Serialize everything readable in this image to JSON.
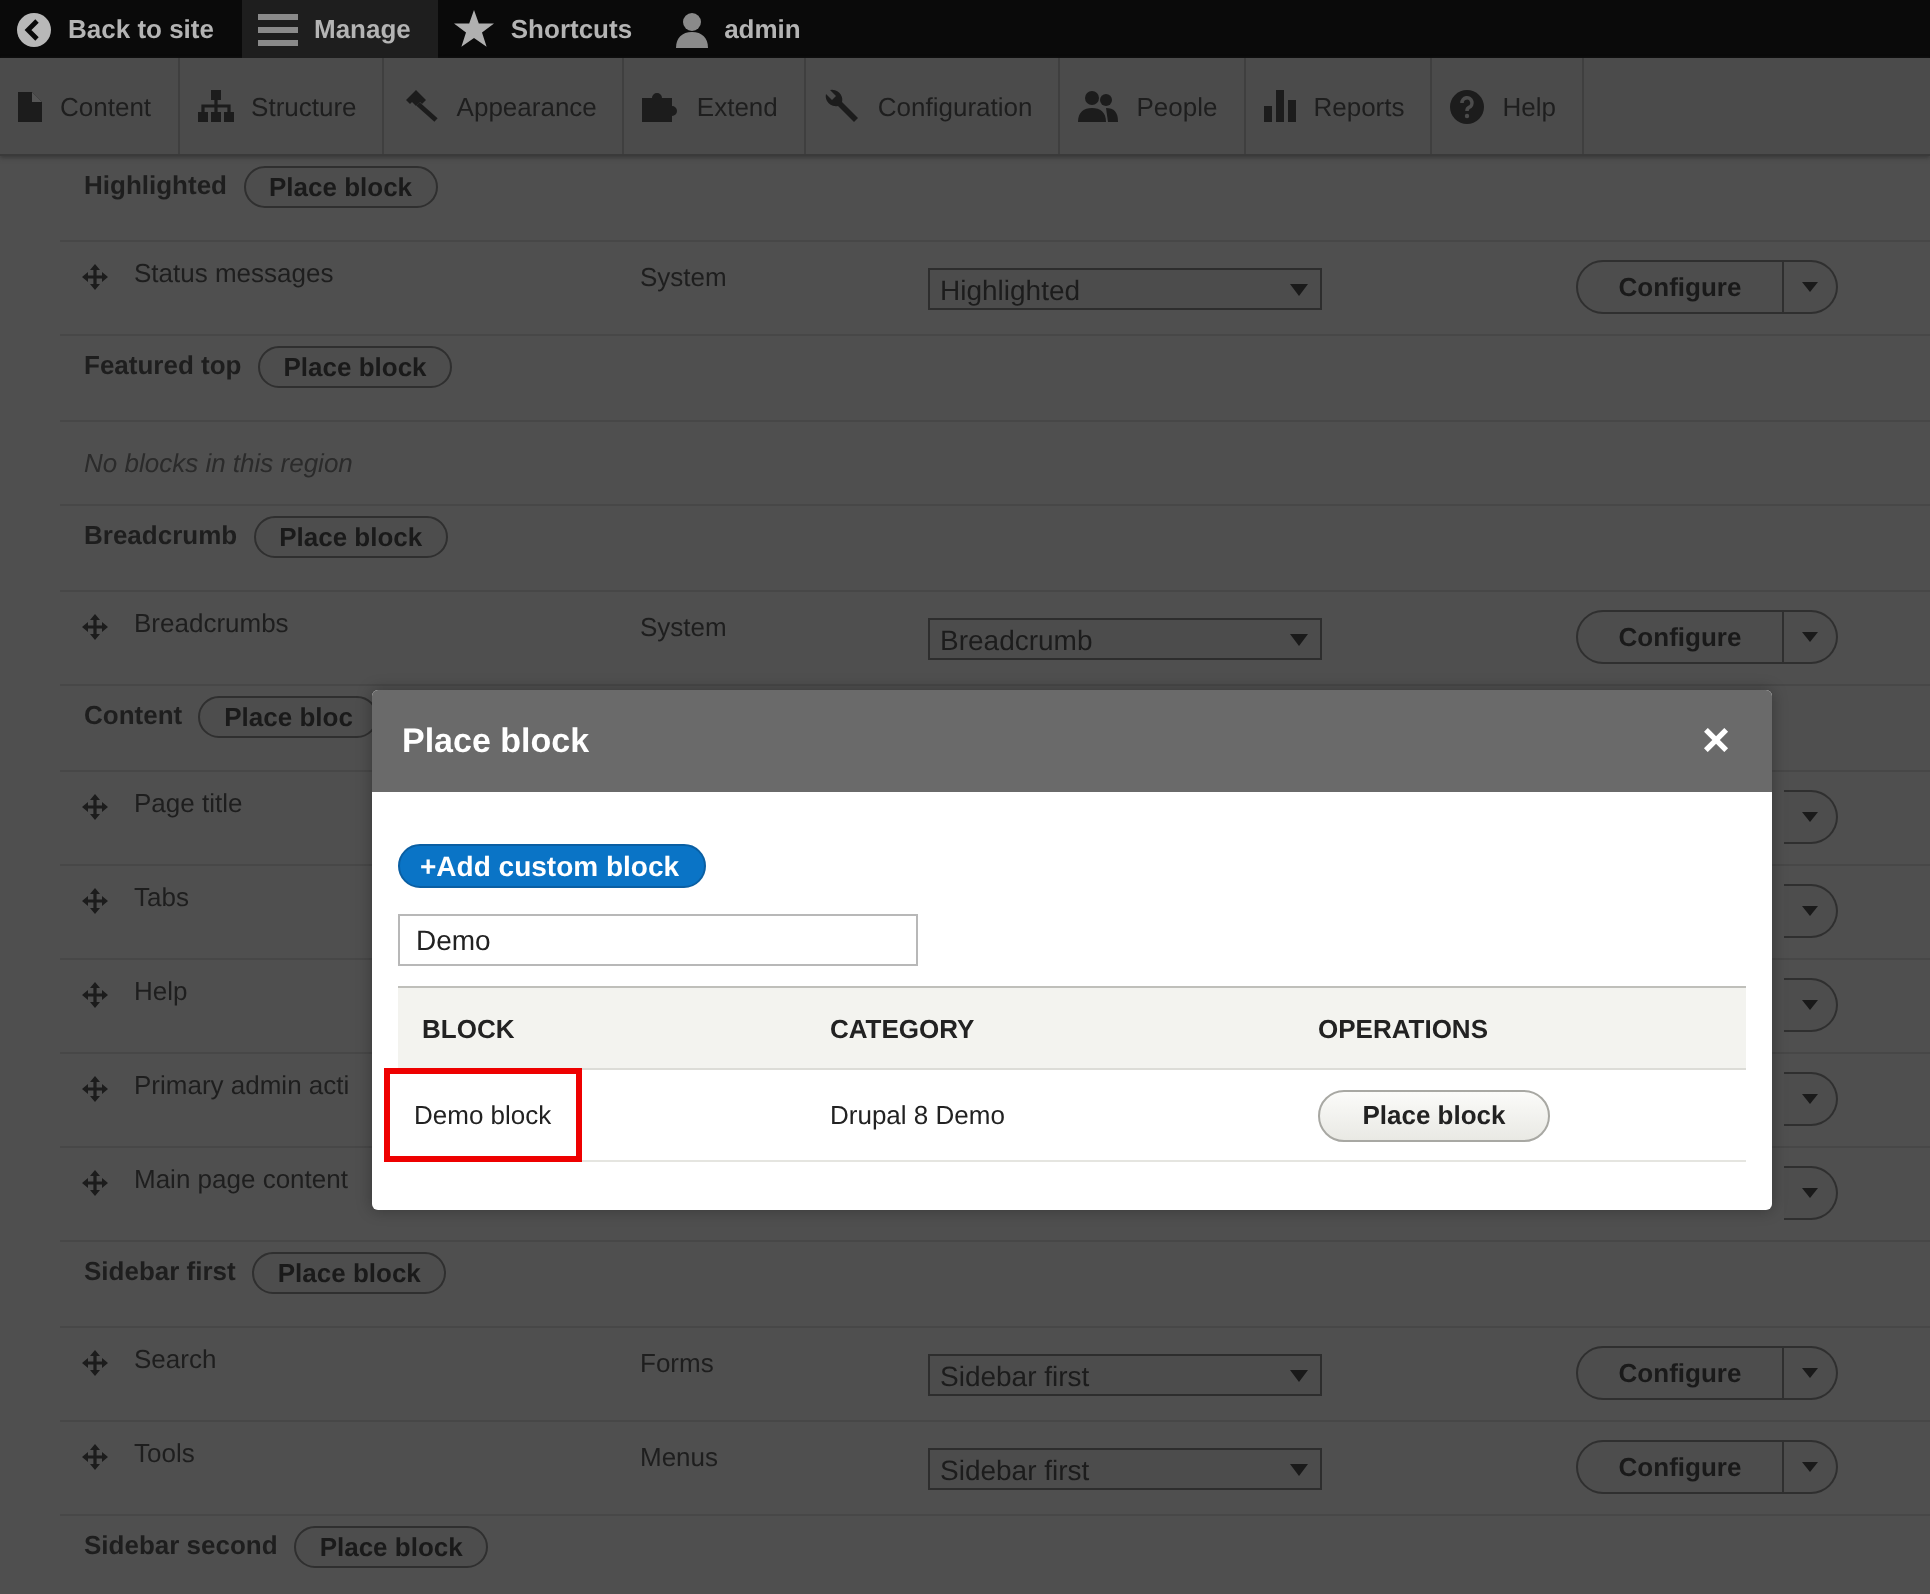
{
  "top_bar": {
    "items": [
      {
        "label": "Back to site",
        "selected": false
      },
      {
        "label": "Manage",
        "selected": true
      },
      {
        "label": "Shortcuts",
        "selected": false
      },
      {
        "label": "admin",
        "selected": false
      }
    ]
  },
  "admin_menu": {
    "items": [
      {
        "label": "Content"
      },
      {
        "label": "Structure"
      },
      {
        "label": "Appearance"
      },
      {
        "label": "Extend"
      },
      {
        "label": "Configuration"
      },
      {
        "label": "People"
      },
      {
        "label": "Reports"
      },
      {
        "label": "Help"
      }
    ]
  },
  "regions": [
    {
      "kind": "region",
      "title": "Highlighted",
      "button": "Place block"
    },
    {
      "kind": "block",
      "name": "Status messages",
      "category": "System",
      "region": "Highlighted",
      "configure": "Configure"
    },
    {
      "kind": "region",
      "title": "Featured top",
      "button": "Place block"
    },
    {
      "kind": "empty",
      "message": "No blocks in this region"
    },
    {
      "kind": "region",
      "title": "Breadcrumb",
      "button": "Place block"
    },
    {
      "kind": "block",
      "name": "Breadcrumbs",
      "category": "System",
      "region": "Breadcrumb",
      "configure": "Configure"
    },
    {
      "kind": "region",
      "title": "Content",
      "button": "Place bloc"
    },
    {
      "kind": "block",
      "name": "Page title"
    },
    {
      "kind": "block",
      "name": "Tabs"
    },
    {
      "kind": "block",
      "name": "Help"
    },
    {
      "kind": "block",
      "name": "Primary admin acti"
    },
    {
      "kind": "block",
      "name": "Main page content"
    },
    {
      "kind": "region",
      "title": "Sidebar first",
      "button": "Place block"
    },
    {
      "kind": "block",
      "name": "Search",
      "category": "Forms",
      "region": "Sidebar first",
      "configure": "Configure"
    },
    {
      "kind": "block",
      "name": "Tools",
      "category": "Menus",
      "region": "Sidebar first",
      "configure": "Configure"
    },
    {
      "kind": "region",
      "title": "Sidebar second",
      "button": "Place block"
    }
  ],
  "dialog": {
    "title": "Place block",
    "close": "×",
    "add_button": "+Add custom block",
    "filter": {
      "value": "Demo"
    },
    "table": {
      "columns": [
        "BLOCK",
        "CATEGORY",
        "OPERATIONS"
      ],
      "rows": [
        {
          "block": "Demo block",
          "category": "Drupal 8 Demo",
          "operation": "Place block",
          "highlighted": true
        }
      ]
    }
  }
}
